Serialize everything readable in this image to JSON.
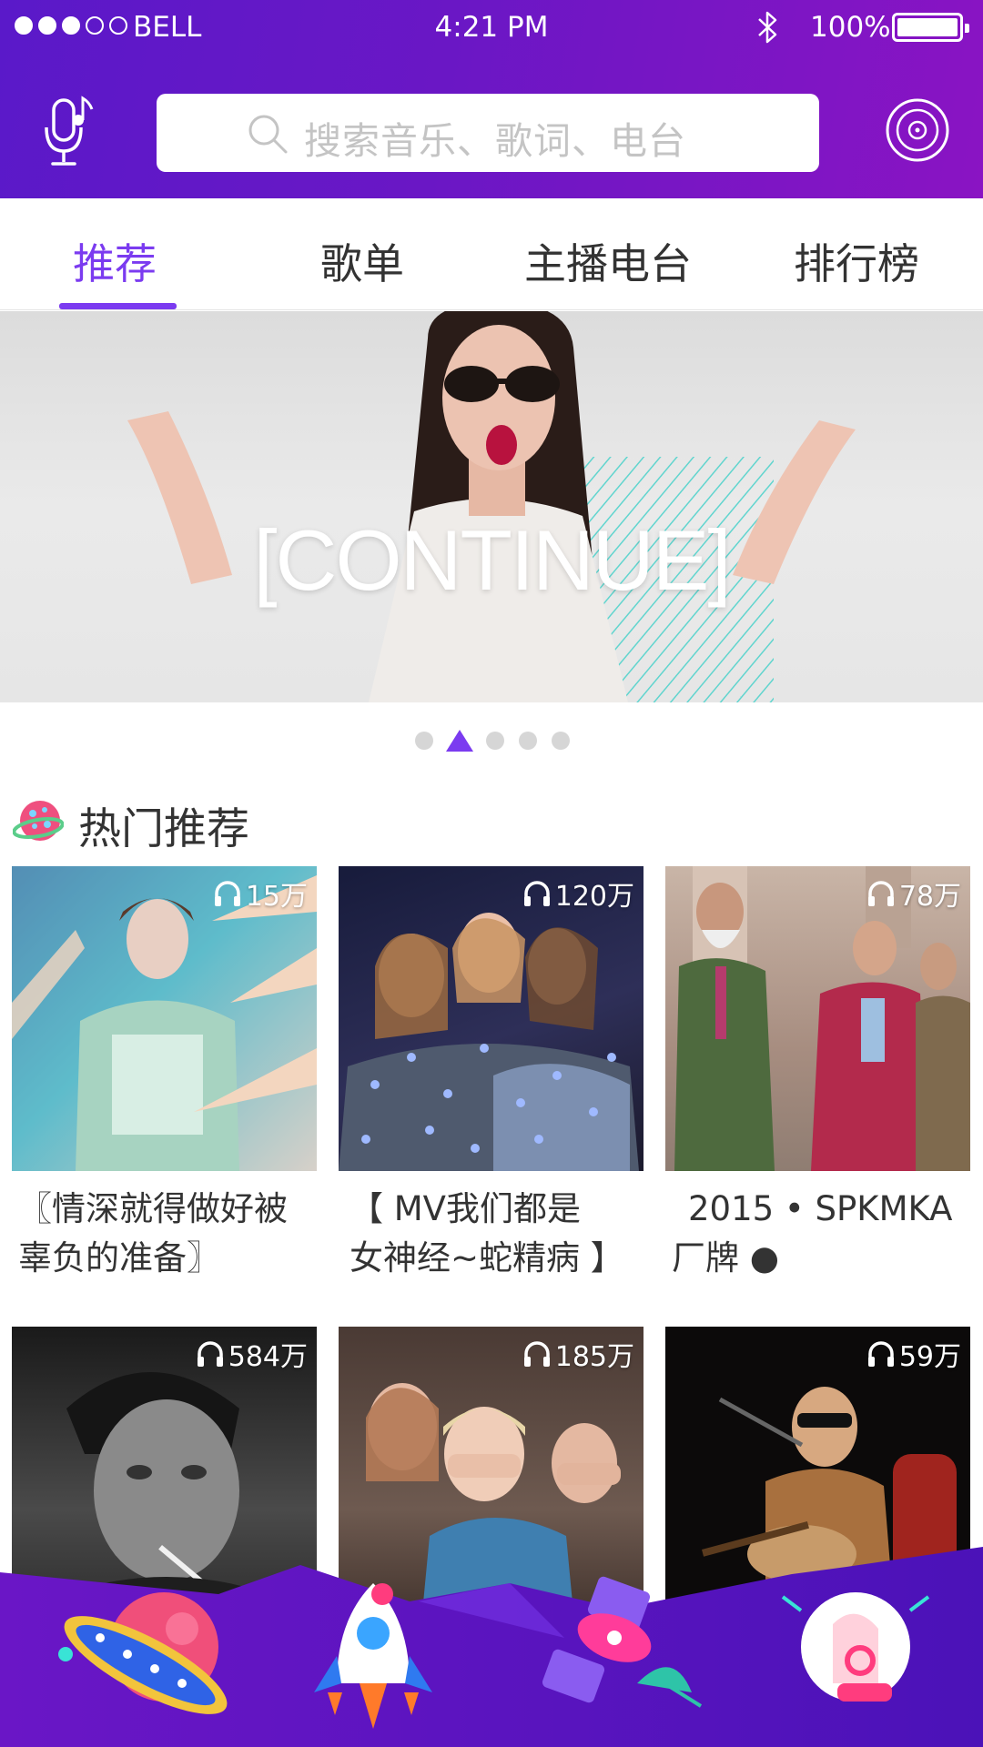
{
  "status": {
    "carrier": "BELL",
    "signal": [
      true,
      true,
      true,
      false,
      false
    ],
    "time": "4:21 PM",
    "battery": "100%"
  },
  "search": {
    "placeholder": "搜索音乐、歌词、电台"
  },
  "tabs": [
    {
      "label": "推荐",
      "active": true
    },
    {
      "label": "歌单",
      "active": false
    },
    {
      "label": "主播电台",
      "active": false
    },
    {
      "label": "排行榜",
      "active": false
    }
  ],
  "banner": {
    "text": "[CONTINUE]",
    "page_count": 5,
    "current_page": 2
  },
  "section": {
    "title": "热门推荐"
  },
  "playlists": [
    {
      "plays": "15万",
      "caption_lines": [
        "〖情深就得做好被",
        "辜负的准备〗"
      ]
    },
    {
      "plays": "120万",
      "caption_lines": [
        "【 MV我们都是",
        "女神经~蛇精病 】"
      ]
    },
    {
      "plays": "78万",
      "caption_lines": [
        "2015 • SPKMKA",
        "厂牌 ●"
      ]
    },
    {
      "plays": "584万",
      "caption_lines": [
        "",
        ""
      ]
    },
    {
      "plays": "185万",
      "caption_lines": [
        "",
        ""
      ]
    },
    {
      "plays": "59万",
      "caption_lines": [
        "",
        ""
      ]
    }
  ],
  "colors": {
    "accent": "#7b3bf0",
    "header_start": "#5a19c9",
    "header_end": "#8a14c3"
  }
}
